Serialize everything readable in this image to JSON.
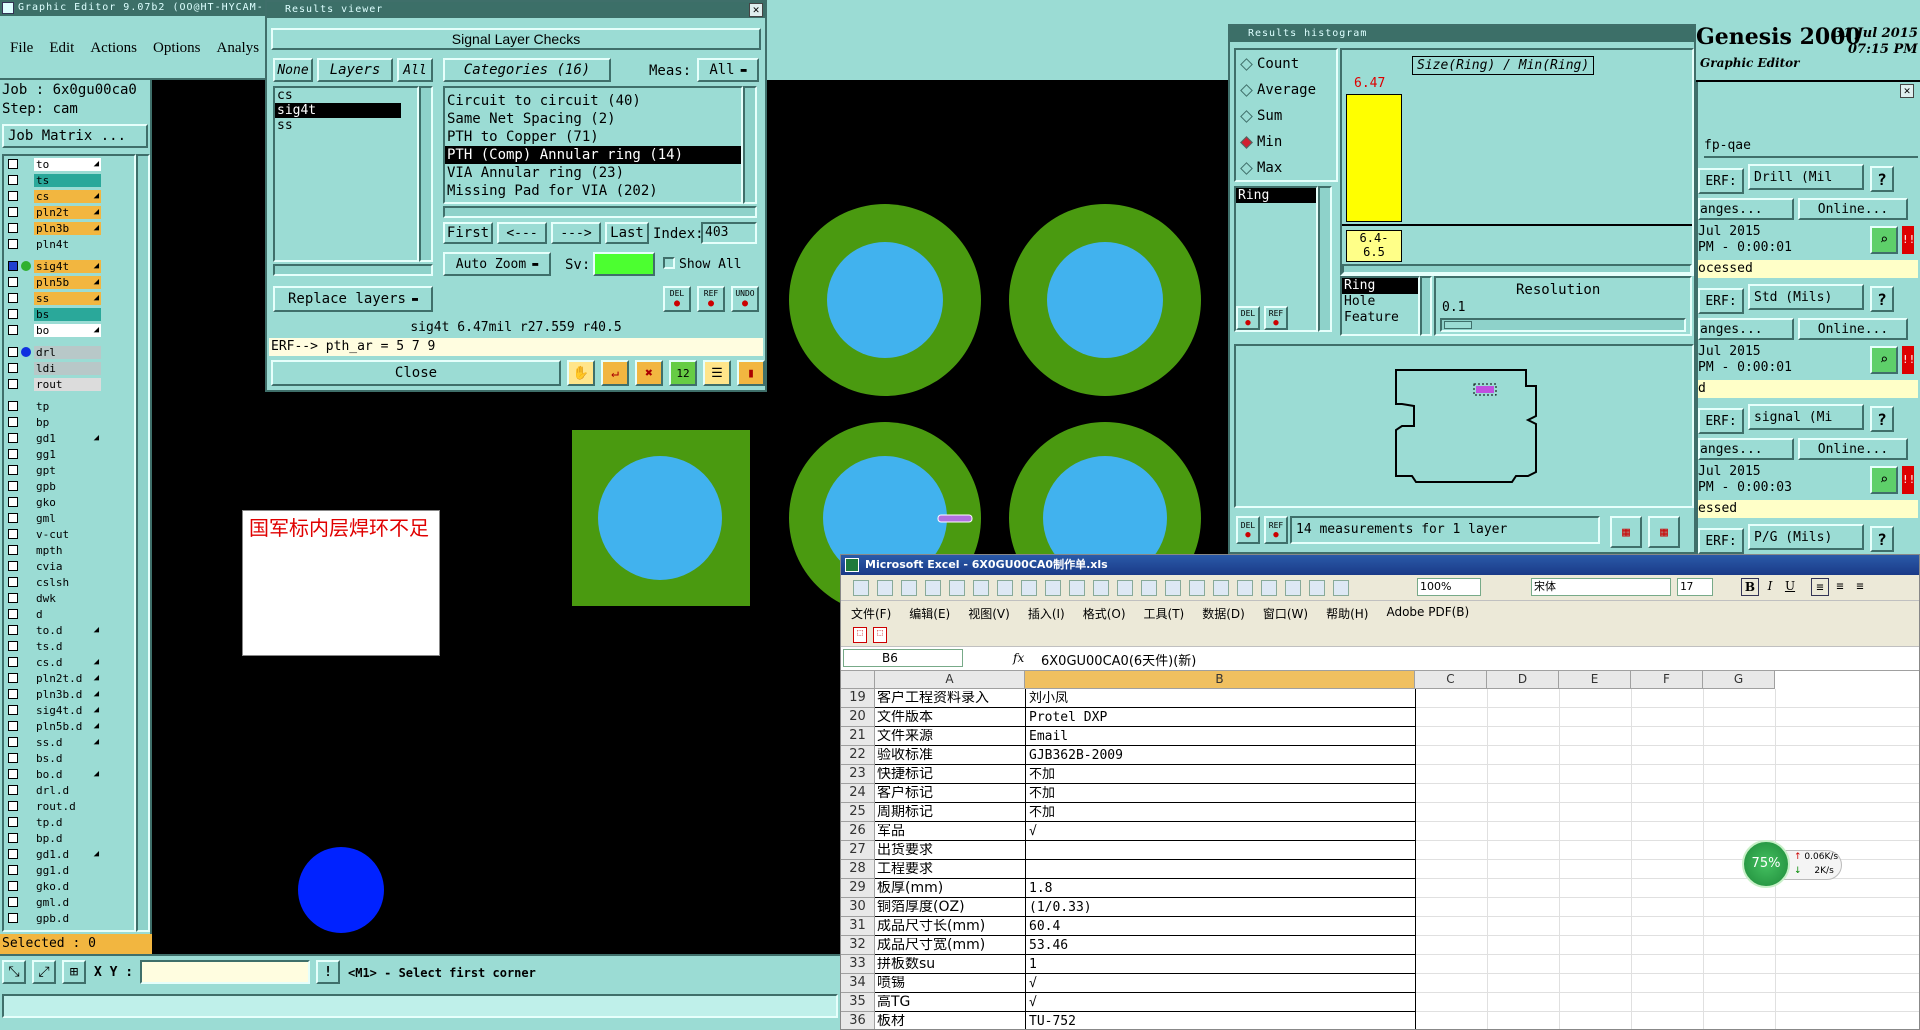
{
  "main_window": {
    "title": "Graphic Editor 9.07b2 (OO@HT-HYCAM-",
    "menu": [
      "File",
      "Edit",
      "Actions",
      "Options",
      "Analys"
    ],
    "job_label": "Job : 6x0gu00ca0",
    "step_label": "Step: cam",
    "job_matrix": "Job Matrix ...",
    "selected": "Selected : 0",
    "xy_label": "X Y :",
    "xy_value": "",
    "prompt": "<M1> - Select first corner"
  },
  "layers": [
    {
      "name": "to",
      "color": "#ffffff",
      "mk": "◢"
    },
    {
      "name": "ts",
      "color": "#2aa89a",
      "mk": ""
    },
    {
      "name": "cs",
      "color": "#f2b640",
      "mk": "◢"
    },
    {
      "name": "pln2t",
      "color": "#f2b640",
      "mk": "◢"
    },
    {
      "name": "pln3b",
      "color": "#f2b640",
      "mk": "◢"
    },
    {
      "name": "pln4t",
      "color": "#9bdcd4",
      "mk": ""
    },
    {
      "name": "sig4t",
      "color": "#f2b640",
      "mk": "◢"
    },
    {
      "name": "pln5b",
      "color": "#f2b640",
      "mk": "◢"
    },
    {
      "name": "ss",
      "color": "#f2b640",
      "mk": "◢"
    },
    {
      "name": "bs",
      "color": "#2aa89a",
      "mk": ""
    },
    {
      "name": "bo",
      "color": "#ffffff",
      "mk": "◢"
    },
    {
      "name": "drl",
      "color": "#b8c8c8",
      "mk": ""
    },
    {
      "name": "ldi",
      "color": "#b8c8c8",
      "mk": ""
    },
    {
      "name": "rout",
      "color": "#dcdcdc",
      "mk": ""
    },
    {
      "name": "tp",
      "color": "#9bdcd4",
      "mk": ""
    },
    {
      "name": "bp",
      "color": "#9bdcd4",
      "mk": ""
    },
    {
      "name": "gd1",
      "color": "#9bdcd4",
      "mk": "◢"
    },
    {
      "name": "gg1",
      "color": "#9bdcd4",
      "mk": ""
    },
    {
      "name": "gpt",
      "color": "#9bdcd4",
      "mk": ""
    },
    {
      "name": "gpb",
      "color": "#9bdcd4",
      "mk": ""
    },
    {
      "name": "gko",
      "color": "#9bdcd4",
      "mk": ""
    },
    {
      "name": "gml",
      "color": "#9bdcd4",
      "mk": ""
    },
    {
      "name": "v-cut",
      "color": "#9bdcd4",
      "mk": ""
    },
    {
      "name": "mpth",
      "color": "#9bdcd4",
      "mk": ""
    },
    {
      "name": "cvia",
      "color": "#9bdcd4",
      "mk": ""
    },
    {
      "name": "cslsh",
      "color": "#9bdcd4",
      "mk": ""
    },
    {
      "name": "dwk",
      "color": "#9bdcd4",
      "mk": ""
    },
    {
      "name": "d",
      "color": "#9bdcd4",
      "mk": ""
    },
    {
      "name": "to.d",
      "color": "#9bdcd4",
      "mk": "◢"
    },
    {
      "name": "ts.d",
      "color": "#9bdcd4",
      "mk": ""
    },
    {
      "name": "cs.d",
      "color": "#9bdcd4",
      "mk": "◢"
    },
    {
      "name": "pln2t.d",
      "color": "#9bdcd4",
      "mk": "◢"
    },
    {
      "name": "pln3b.d",
      "color": "#9bdcd4",
      "mk": "◢"
    },
    {
      "name": "sig4t.d",
      "color": "#9bdcd4",
      "mk": "◢"
    },
    {
      "name": "pln5b.d",
      "color": "#9bdcd4",
      "mk": "◢"
    },
    {
      "name": "ss.d",
      "color": "#9bdcd4",
      "mk": "◢"
    },
    {
      "name": "bs.d",
      "color": "#9bdcd4",
      "mk": ""
    },
    {
      "name": "bo.d",
      "color": "#9bdcd4",
      "mk": "◢"
    },
    {
      "name": "drl.d",
      "color": "#9bdcd4",
      "mk": ""
    },
    {
      "name": "rout.d",
      "color": "#9bdcd4",
      "mk": ""
    },
    {
      "name": "tp.d",
      "color": "#9bdcd4",
      "mk": ""
    },
    {
      "name": "bp.d",
      "color": "#9bdcd4",
      "mk": ""
    },
    {
      "name": "gd1.d",
      "color": "#9bdcd4",
      "mk": "◢"
    },
    {
      "name": "gg1.d",
      "color": "#9bdcd4",
      "mk": ""
    },
    {
      "name": "gko.d",
      "color": "#9bdcd4",
      "mk": ""
    },
    {
      "name": "gml.d",
      "color": "#9bdcd4",
      "mk": ""
    },
    {
      "name": "gpb.d",
      "color": "#9bdcd4",
      "mk": ""
    }
  ],
  "annotation_note": "国军标内层焊环不足",
  "results_viewer": {
    "title": "Results viewer",
    "header": "Signal Layer Checks",
    "none_btn": "None",
    "layers_btn": "Layers",
    "all_btn": "All",
    "categories_btn": "Categories (16)",
    "meas_label": "Meas:",
    "meas_value": "All",
    "layer_list": [
      "cs",
      "sig4t",
      "ss"
    ],
    "categories": [
      "Circuit to circuit (40)",
      "Same Net Spacing (2)",
      "PTH to Copper (71)",
      "PTH (Comp) Annular ring (14)",
      "VIA Annular ring (23)",
      "Missing Pad for VIA (202)"
    ],
    "first_btn": "First",
    "prev_btn": "<---",
    "next_btn": "--->",
    "last_btn": "Last",
    "index_label": "Index:",
    "index_value": "403",
    "auto_zoom": "Auto Zoom",
    "sv_label": "Sv:",
    "show_all": "Show All",
    "replace_layers": "Replace layers",
    "status_line": "sig4t 6.47mil r27.559 r40.5",
    "erf_line": "ERF--> pth_ar = 5 7 9",
    "close_btn": "Close",
    "del_label": "DEL",
    "ref_label": "REF",
    "undo_label": "UNDO"
  },
  "histogram": {
    "title": "Results histogram",
    "options": [
      "Count",
      "Average",
      "Sum",
      "Min",
      "Max"
    ],
    "selected_option": "Min",
    "chart_title": "Size(Ring) / Min(Ring)",
    "bar_value_label": "6.47",
    "range_label_1": "6.4-",
    "range_label_2": "6.5",
    "list_items": [
      "Ring"
    ],
    "type_list": [
      "Ring",
      "Hole",
      "Feature"
    ],
    "resolution_label": "Resolution",
    "resolution_value": "0.1",
    "measurements": "14 measurements for 1 layer",
    "del_label": "DEL",
    "ref_label": "REF"
  },
  "genesis": {
    "brand": "Genesis 2000",
    "subtitle": "Graphic Editor",
    "date": "31 Jul 2015",
    "time": "07:15 PM"
  },
  "fp_panel": {
    "title": "fp-qae",
    "rows": [
      {
        "erf": "ERF:",
        "value": "Drill (Mil",
        "ranges": "anges...",
        "online": "Online...",
        "date": "Jul 2015",
        "time": "PM - 0:00:01",
        "status": "ocessed",
        "status_bg": "#ffffc8"
      },
      {
        "erf": "ERF:",
        "value": "Std (Mils)",
        "ranges": "anges...",
        "online": "Online...",
        "date": "Jul 2015",
        "time": "PM - 0:00:01",
        "status": "d",
        "status_bg": "#ffffc8"
      },
      {
        "erf": "ERF:",
        "value": "signal (Mi",
        "ranges": "anges...",
        "online": "Online...",
        "date": "Jul 2015",
        "time": "PM - 0:00:03",
        "status": "essed",
        "status_bg": "#ffffc8"
      },
      {
        "erf": "ERF:",
        "value": "P/G (Mils)",
        "ranges": "",
        "online": "",
        "date": "",
        "time": "",
        "status": "",
        "status_bg": "#9bdcd4"
      }
    ]
  },
  "excel": {
    "title": "Microsoft Excel - 6X0GU00CA0制作单.xls",
    "menu": [
      "文件(F)",
      "编辑(E)",
      "视图(V)",
      "插入(I)",
      "格式(O)",
      "工具(T)",
      "数据(D)",
      "窗口(W)",
      "帮助(H)",
      "Adobe PDF(B)"
    ],
    "zoom": "100%",
    "font": "宋体",
    "font_size": "17",
    "name_box": "B6",
    "fx": "fx",
    "formula": "6X0GU00CA0(6天件)(新)",
    "columns": [
      "A",
      "B",
      "C",
      "D",
      "E",
      "F",
      "G"
    ],
    "rows": [
      {
        "n": "19",
        "a": "客户工程资料录入",
        "b": "刘小凤"
      },
      {
        "n": "20",
        "a": "文件版本",
        "b": "Protel DXP"
      },
      {
        "n": "21",
        "a": "文件来源",
        "b": "Email"
      },
      {
        "n": "22",
        "a": "验收标准",
        "b": "GJB362B-2009"
      },
      {
        "n": "23",
        "a": "快捷标记",
        "b": "不加"
      },
      {
        "n": "24",
        "a": "客户标记",
        "b": "不加"
      },
      {
        "n": "25",
        "a": "周期标记",
        "b": "不加"
      },
      {
        "n": "26",
        "a": "军品",
        "b": "√"
      },
      {
        "n": "27",
        "a": "出货要求",
        "b": ""
      },
      {
        "n": "28",
        "a": "工程要求",
        "b": ""
      },
      {
        "n": "29",
        "a": "板厚(mm)",
        "b": "1.8"
      },
      {
        "n": "30",
        "a": "铜箔厚度(OZ)",
        "b": "(1/0.33)"
      },
      {
        "n": "31",
        "a": "成品尺寸长(mm)",
        "b": "60.4"
      },
      {
        "n": "32",
        "a": "成品尺寸宽(mm)",
        "b": "53.46"
      },
      {
        "n": "33",
        "a": "拼板数su",
        "b": "1"
      },
      {
        "n": "34",
        "a": "喷锡",
        "b": "√"
      },
      {
        "n": "35",
        "a": "高TG",
        "b": "√"
      },
      {
        "n": "36",
        "a": "板材",
        "b": "TU-752"
      }
    ]
  },
  "net_widget": {
    "percent": "75%",
    "up": "0.06K/s",
    "down": "2K/s"
  }
}
